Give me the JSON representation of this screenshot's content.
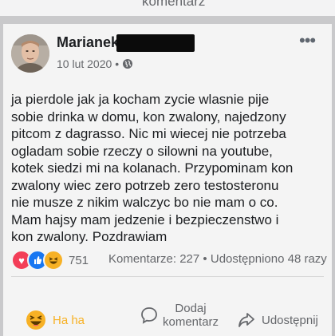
{
  "top_strip": {
    "text": "komentarz"
  },
  "post": {
    "author": "Marianek",
    "date": "10 lut 2020",
    "body_lines": [
      "ja pierdole jak ja kocham zycie wlasnie pije",
      "sobie drinka w domu, kon zwalony, najedzony",
      "pitcom z dagrasso. Nic mi wiecej nie potrzeba",
      "ogladam sobie rzeczy o silowni na youtube,",
      "kotek siedzi mi na kolanach. Przypominam kon",
      "zwalony wiec zero potrzeb zero testosteronu",
      "nie musze z nikim walczyc bo nie mam o co.",
      "Mam hajsy mam jedzenie i bezpieczenstwo i",
      "kon zwalony. Pozdrawiam"
    ],
    "reaction_count": "751",
    "comments": "Komentarze: 227",
    "separator": "•",
    "shares": "Udostępniono 48 razy"
  },
  "actions": {
    "haha": "Ha ha",
    "comment_line1": "Dodaj",
    "comment_line2": "komentarz",
    "share": "Udostępnij"
  },
  "icons": {
    "audience": "globe-icon",
    "more": "more-options-icon",
    "reactions": [
      "love-reaction-icon",
      "like-reaction-icon",
      "haha-reaction-icon"
    ]
  },
  "colors": {
    "like_blue": "#1877f2",
    "love_red": "#f33e58",
    "haha_yellow": "#f7b125",
    "secondary_text": "#65676b"
  }
}
